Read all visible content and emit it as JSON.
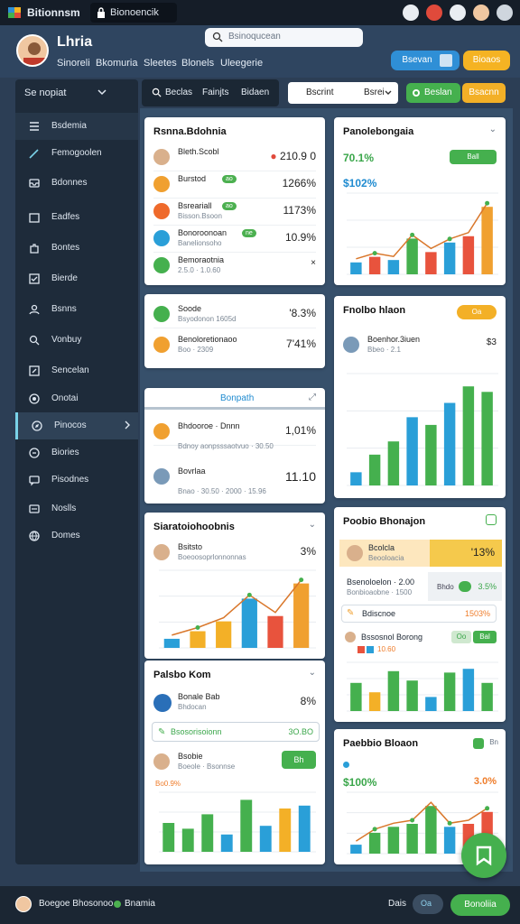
{
  "topbar": {
    "app_name": "Bitionnsm",
    "tab_title": "Bionoencik"
  },
  "header": {
    "brand": "Lhria",
    "subnav": [
      "Sinoreli",
      "Bkomuria",
      "Sleetes",
      "Blonels",
      "Uleegerie"
    ],
    "search_placeholder": "Bsinoqucean",
    "primary_button": "Bsevan",
    "secondary_button": "Bioaos"
  },
  "sidebar": {
    "header": "Se nopiat",
    "items": [
      {
        "label": "Bsdemia",
        "icon": "menu-icon"
      },
      {
        "label": "Femogoolen",
        "icon": "pen-icon"
      },
      {
        "label": "Bdonnes",
        "icon": "inbox-icon"
      },
      {
        "label": "Eadfes",
        "icon": "calendar-icon"
      },
      {
        "label": "Bontes",
        "icon": "puzzle-icon"
      },
      {
        "label": "Bierde",
        "icon": "checkbox-icon"
      },
      {
        "label": "Bsnns",
        "icon": "users-icon"
      },
      {
        "label": "Vonbuy",
        "icon": "search-icon"
      },
      {
        "label": "Sencelan",
        "icon": "edit-icon"
      },
      {
        "label": "Onotai",
        "icon": "target-icon"
      },
      {
        "label": "Pinocos",
        "icon": "compass-icon"
      },
      {
        "label": "Biories",
        "icon": "refresh-icon"
      },
      {
        "label": "Pisodnes",
        "icon": "chat-icon"
      },
      {
        "label": "Noslls",
        "icon": "card-icon"
      },
      {
        "label": "Domes",
        "icon": "globe-icon"
      }
    ]
  },
  "filterbar": {
    "labels": [
      "Beclas",
      "Fainjts",
      "Bidaen"
    ]
  },
  "select": {
    "value": "Bscrint",
    "value2": "Bsrei"
  },
  "pills": {
    "green": "Beslan",
    "yellow": "Bsacnn"
  },
  "cards": {
    "top_left": {
      "title": "Rsnna.Bdohnia",
      "rows": [
        {
          "name": "Bleth.Scobl",
          "sub": "",
          "value": "210.9 0",
          "tag": ""
        },
        {
          "name": "Burstod",
          "sub": "",
          "value": "1266%",
          "tag": "ao"
        },
        {
          "name": "Bsreariall",
          "sub": "Bisson.Bsoon",
          "value": "1173%",
          "tag": "ao"
        },
        {
          "name": "Bonoroonoan",
          "sub": "Banelionsoho",
          "value": "10.9%",
          "tag": "ne"
        },
        {
          "name": "Bemoraotnia",
          "sub": "2.5.0 · 1.0.60",
          "value": "",
          "tag": ""
        }
      ]
    },
    "mid_left": {
      "rows": [
        {
          "name": "Soode",
          "sub": "Bsyodonon 1605d",
          "value": "'8.3%"
        },
        {
          "name": "Benoloretionaoo",
          "sub": "Boo · 2309",
          "value": "7'41%"
        }
      ]
    },
    "tab_card": {
      "tab": "Bonpath",
      "rows": [
        {
          "name": "Bhdooroe · Dnnn",
          "sub": "Bdnoy aonpsssaotvuo · 30.50",
          "value": "1,01%"
        },
        {
          "name": "Bovrlaa",
          "sub": "Bnao · 30.50 · 2000 · 15.96",
          "value": "11.10"
        }
      ]
    },
    "right_top": {
      "title": "Panolebongaia",
      "kpi": "70.1%",
      "kpi2": "$102%",
      "badge": "Ball"
    },
    "right_mid": {
      "title": "Fnolbo hlaon",
      "badge": "Oa",
      "person": "Boenhor.3iuen",
      "sub": "Bbeo · 2.1",
      "value": "$3"
    },
    "left_chart": {
      "title": "Siaratoiohoobnis",
      "person": "Bsitsto",
      "sub": "Boeoosoprlonnonnas",
      "value": "3%"
    },
    "left_bottom": {
      "title": "Palsbo Kom",
      "rows": [
        {
          "name": "Bonale Bab",
          "sub": "Bhdocan",
          "value": "8%"
        }
      ],
      "link": "Bsosorisoionn",
      "link_val": "3O.BO",
      "person": "Bsobie",
      "sub2": "Boeole · Bsonnse",
      "btn": "Bh",
      "foot": "Bo0.9%"
    },
    "right_lower": {
      "title": "Poobio Bhonajon",
      "row1": {
        "name": "Bcolcla",
        "sub": "Beooloacia",
        "value": "'13%"
      },
      "row2": {
        "name": "Bsenoloelon · 2.00",
        "sub": "Bonbioaobne · 1500",
        "btn": "Bhdo",
        "value": "3.5%"
      },
      "row3": {
        "name": "Bdiscnoe",
        "value": "1503%"
      },
      "row4": {
        "name": "Bssosnol Borong",
        "badge": "Oo",
        "small": "10.60",
        "btn": "Bal"
      }
    },
    "right_last": {
      "title": "Paebbio Bloaon",
      "kpi": "$100%",
      "kpi2": "3.0%",
      "badge": "Bn"
    }
  },
  "colors": {
    "green": "#45b04e",
    "blue": "#2a9fd8",
    "orange": "#f0a030",
    "red": "#e8533d",
    "yellow": "#f3b027"
  },
  "bottombar": {
    "user": "Boegoe Bhosonoo",
    "status": "Bnamia",
    "label": "Dais",
    "toggle": "Oa",
    "button": "Bonoliia"
  }
}
